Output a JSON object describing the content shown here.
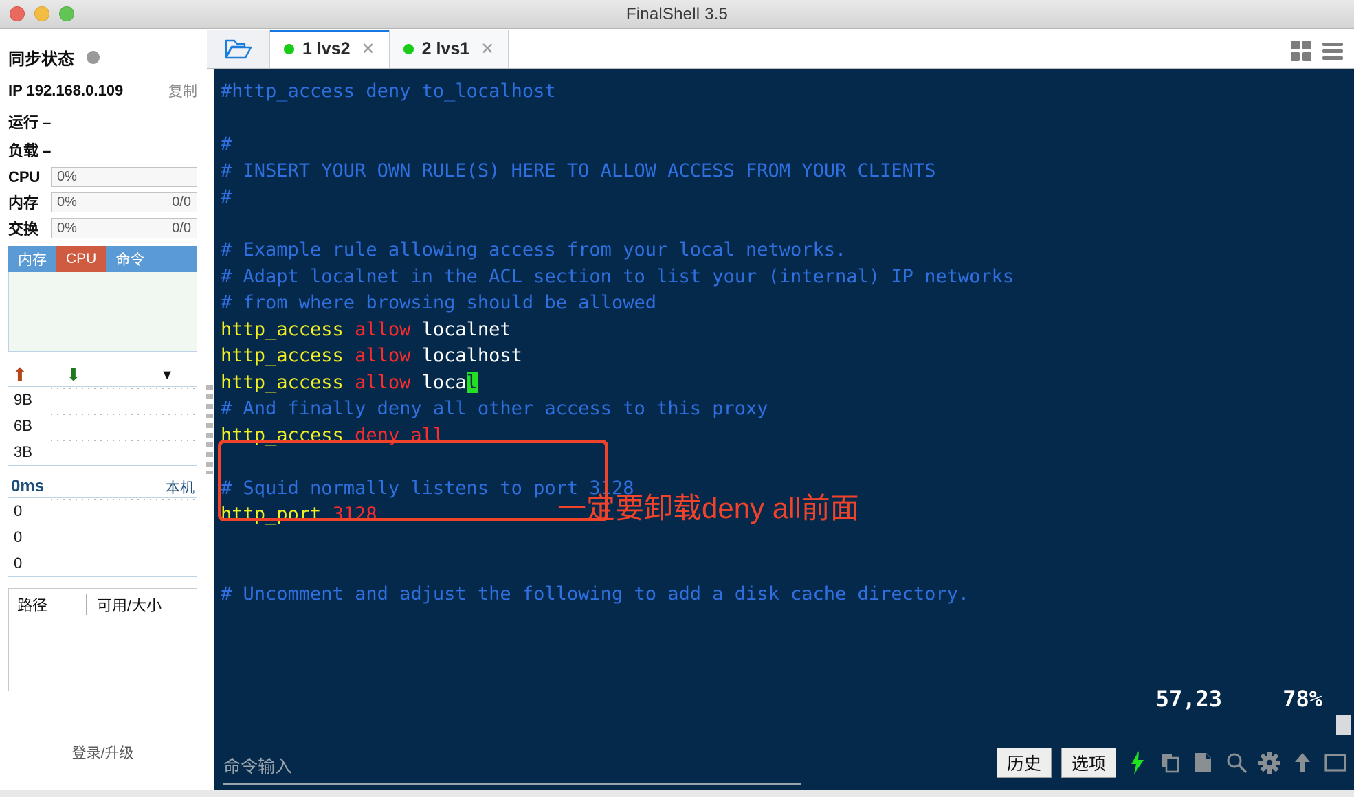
{
  "window": {
    "title": "FinalShell 3.5",
    "controls": [
      "close",
      "minimize",
      "maximize"
    ]
  },
  "sidebar": {
    "sync_status_label": "同步状态",
    "ip_label": "IP 192.168.0.109",
    "copy_label": "复制",
    "uptime_label": "运行 –",
    "load_label": "负载 –",
    "meters": [
      {
        "name": "CPU",
        "value": "0%",
        "extra": ""
      },
      {
        "name": "内存",
        "value": "0%",
        "extra": "0/0"
      },
      {
        "name": "交换",
        "value": "0%",
        "extra": "0/0"
      }
    ],
    "minitabs": [
      {
        "label": "内存",
        "active": false
      },
      {
        "label": "CPU",
        "active": true
      },
      {
        "label": "命令",
        "active": false
      }
    ],
    "net": {
      "up_icon": "arrow-up-icon",
      "down_icon": "arrow-down-icon",
      "menu_icon": "caret-down-icon",
      "ticks": [
        "9B",
        "6B",
        "3B"
      ]
    },
    "latency": {
      "value": "0ms",
      "host": "本机",
      "ticks": [
        "0",
        "0",
        "0"
      ]
    },
    "disk": {
      "col_path": "路径",
      "col_size": "可用/大小"
    },
    "login_label": "登录/升级"
  },
  "tabstrip": {
    "folder_icon": "open-folder-icon",
    "tabs": [
      {
        "label": "1 lvs2",
        "active": true,
        "status": "connected"
      },
      {
        "label": "2 lvs1",
        "active": false,
        "status": "connected"
      }
    ],
    "close_glyph": "✕",
    "grid_icon": "grid-view-icon",
    "menu_icon": "hamburger-menu-icon"
  },
  "terminal": {
    "lines": [
      {
        "segments": [
          {
            "t": "#http_access deny to_localhost",
            "c": "comment"
          }
        ]
      },
      {
        "segments": [
          {
            "t": "",
            "c": "comment"
          }
        ]
      },
      {
        "segments": [
          {
            "t": "#",
            "c": "comment"
          }
        ]
      },
      {
        "segments": [
          {
            "t": "# INSERT YOUR OWN RULE(S) HERE TO ALLOW ACCESS FROM YOUR CLIENTS",
            "c": "comment"
          }
        ]
      },
      {
        "segments": [
          {
            "t": "#",
            "c": "comment"
          }
        ]
      },
      {
        "segments": [
          {
            "t": "",
            "c": "comment"
          }
        ]
      },
      {
        "segments": [
          {
            "t": "# Example rule allowing access from your local networks.",
            "c": "comment"
          }
        ]
      },
      {
        "segments": [
          {
            "t": "# Adapt localnet in the ACL section to list your (internal) IP networks",
            "c": "comment"
          }
        ]
      },
      {
        "segments": [
          {
            "t": "# from where browsing should be allowed",
            "c": "comment"
          }
        ]
      },
      {
        "segments": [
          {
            "t": "http_access ",
            "c": "key"
          },
          {
            "t": "allow ",
            "c": "red"
          },
          {
            "t": "localnet",
            "c": "white"
          }
        ]
      },
      {
        "segments": [
          {
            "t": "http_access ",
            "c": "key"
          },
          {
            "t": "allow ",
            "c": "red"
          },
          {
            "t": "localhost",
            "c": "white"
          }
        ]
      },
      {
        "segments": [
          {
            "t": "http_access ",
            "c": "key"
          },
          {
            "t": "allow ",
            "c": "red"
          },
          {
            "t": "loca",
            "c": "white"
          },
          {
            "t": "l",
            "c": "cursor"
          }
        ]
      },
      {
        "segments": [
          {
            "t": "# And finally deny all other access to this proxy",
            "c": "comment"
          }
        ]
      },
      {
        "segments": [
          {
            "t": "http_access ",
            "c": "key"
          },
          {
            "t": "deny all",
            "c": "red"
          }
        ]
      },
      {
        "segments": [
          {
            "t": "",
            "c": "comment"
          }
        ]
      },
      {
        "segments": [
          {
            "t": "# Squid normally listens to port 3128",
            "c": "comment"
          }
        ]
      },
      {
        "segments": [
          {
            "t": "http_port ",
            "c": "key"
          },
          {
            "t": "3128",
            "c": "red"
          }
        ]
      },
      {
        "segments": [
          {
            "t": "",
            "c": "comment"
          }
        ]
      },
      {
        "segments": [
          {
            "t": "",
            "c": "comment"
          }
        ]
      },
      {
        "segments": [
          {
            "t": "# Uncomment and adjust the following to add a disk cache directory.",
            "c": "comment"
          }
        ]
      }
    ],
    "annotation": "一定要卸载deny all前面",
    "cursor_position": "57,23",
    "scroll_percent": "78%",
    "highlight_color": "#f0432a",
    "bg_color": "#05294a"
  },
  "bottombar": {
    "input_placeholder": "命令输入",
    "input_value": "",
    "buttons": [
      {
        "label": "历史",
        "name": "history-button"
      },
      {
        "label": "选项",
        "name": "options-button"
      }
    ],
    "icons": [
      {
        "name": "lightning-bolt-icon",
        "glyph": "⚡"
      },
      {
        "name": "copy-icon"
      },
      {
        "name": "paste-icon"
      },
      {
        "name": "search-icon"
      },
      {
        "name": "gear-icon"
      },
      {
        "name": "upload-arrow-icon"
      },
      {
        "name": "window-icon"
      }
    ]
  }
}
